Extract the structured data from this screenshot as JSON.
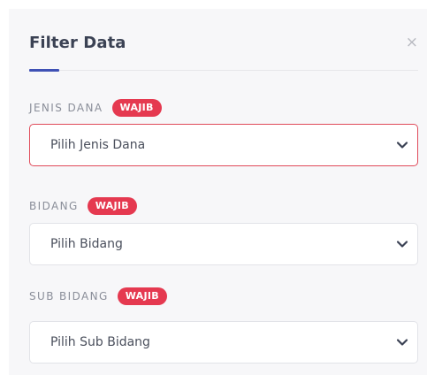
{
  "modal": {
    "title": "Filter Data",
    "close_glyph": "×"
  },
  "fields": [
    {
      "label": "JENIS DANA",
      "badge": "WAJIB",
      "value": "Pilih Jenis Dana",
      "invalid": true
    },
    {
      "label": "BIDANG",
      "badge": "WAJIB",
      "value": "Pilih Bidang",
      "invalid": false
    },
    {
      "label": "SUB BIDANG",
      "badge": "WAJIB",
      "value": "Pilih Sub Bidang",
      "invalid": false
    }
  ],
  "colors": {
    "accent": "#3f51b5",
    "badge": "#e53950",
    "error_border": "#e04b5a"
  },
  "icons": {
    "close": "close-icon",
    "dropdown": "chevron-down-icon"
  }
}
